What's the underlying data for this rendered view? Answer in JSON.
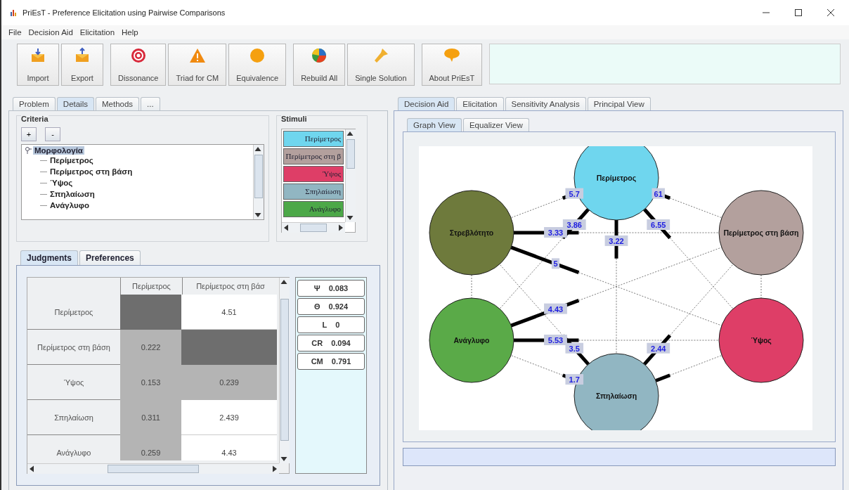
{
  "window": {
    "title": "PriEsT - Preference Elicitation using Pairwise Comparisons"
  },
  "menu": [
    "File",
    "Decision Aid",
    "Elicitation",
    "Help"
  ],
  "toolbar": [
    {
      "label": "Import"
    },
    {
      "label": "Export"
    },
    {
      "label": "Dissonance"
    },
    {
      "label": "Triad for CM"
    },
    {
      "label": "Equivalence"
    },
    {
      "label": "Rebuild All"
    },
    {
      "label": "Single Solution"
    },
    {
      "label": "About PriEsT"
    }
  ],
  "left_tabs": [
    {
      "label": "Problem",
      "selected": false
    },
    {
      "label": "Details",
      "selected": true
    },
    {
      "label": "Methods",
      "selected": false
    },
    {
      "label": "...",
      "selected": false
    }
  ],
  "criteria": {
    "title": "Criteria",
    "buttons": [
      "+",
      "-"
    ],
    "tree": {
      "label": "Μορφολογία",
      "selected": true,
      "expanded": true,
      "children": [
        {
          "label": "Περίμετρος"
        },
        {
          "label": "Περίμετρος στη βάση"
        },
        {
          "label": "Ύψος"
        },
        {
          "label": "Σπηλαίωση"
        },
        {
          "label": "Ανάγλυφο"
        }
      ]
    }
  },
  "stimuli": {
    "title": "Stimuli",
    "items": [
      {
        "label": "Περίμετρος",
        "color": "#6fd6ee"
      },
      {
        "label": "Περίμετρος στη β",
        "color": "#b3a09d"
      },
      {
        "label": "Ύψος",
        "color": "#de3e67"
      },
      {
        "label": "Σπηλαίωση",
        "color": "#91b6c2"
      },
      {
        "label": "Ανάγλυφο",
        "color": "#4ca848"
      }
    ]
  },
  "judgment_tabs": [
    {
      "label": "Judgments",
      "selected": true
    },
    {
      "label": "Preferences",
      "selected": false
    }
  ],
  "matrix": {
    "columns": [
      "Περίμετρος",
      "Περίμετρος στη βάσ"
    ],
    "rows": [
      {
        "label": "Περίμετρος",
        "cells": [
          {
            "kind": "diagonal"
          },
          {
            "kind": "upper",
            "value": "4.51"
          }
        ]
      },
      {
        "label": "Περίμετρος στη βάση",
        "cells": [
          {
            "kind": "lower",
            "value": "0.222"
          },
          {
            "kind": "diagonal"
          }
        ]
      },
      {
        "label": "Ύψος",
        "cells": [
          {
            "kind": "lower",
            "value": "0.153"
          },
          {
            "kind": "lower",
            "value": "0.239"
          }
        ]
      },
      {
        "label": "Σπηλαίωση",
        "cells": [
          {
            "kind": "lower",
            "value": "0.311"
          },
          {
            "kind": "upper",
            "value": "2.439"
          }
        ]
      },
      {
        "label": "Ανάγλυφο",
        "cells": [
          {
            "kind": "lower",
            "value": "0.259"
          },
          {
            "kind": "upper",
            "value": "4.43"
          }
        ]
      }
    ]
  },
  "metrics": [
    {
      "label": "Ψ",
      "value": "0.083"
    },
    {
      "label": "Θ",
      "value": "0.924"
    },
    {
      "label": "L",
      "value": "0"
    },
    {
      "label": "CR",
      "value": "0.094"
    },
    {
      "label": "CM",
      "value": "0.791"
    }
  ],
  "right_tabs": [
    {
      "label": "Decision Aid",
      "selected": true
    },
    {
      "label": "Elicitation",
      "selected": false
    },
    {
      "label": "Sensitivity Analysis",
      "selected": false
    },
    {
      "label": "Principal View",
      "selected": false
    }
  ],
  "view_tabs": [
    {
      "label": "Graph View",
      "selected": true
    },
    {
      "label": "Equalizer View",
      "selected": false
    }
  ],
  "graph": {
    "nodes": [
      {
        "label": "Περίμετρος",
        "color": "#6fd6ee"
      },
      {
        "label": "Στρεβλότητο",
        "color": "#6e7a3c"
      },
      {
        "label": "Περίμετρος στη βάση",
        "color": "#b3a09d"
      },
      {
        "label": "Ανάγλυφο",
        "color": "#5aaa48"
      },
      {
        "label": "Ύψος",
        "color": "#de3e67"
      },
      {
        "label": "Σπηλαίωση",
        "color": "#91b6c2"
      }
    ],
    "edge_labels": [
      "5.7",
      "61",
      "3.86",
      "6.55",
      "3.22",
      "3.33",
      "5",
      "4.43",
      "5.53",
      "3.5",
      "1.7",
      "2.44"
    ]
  }
}
